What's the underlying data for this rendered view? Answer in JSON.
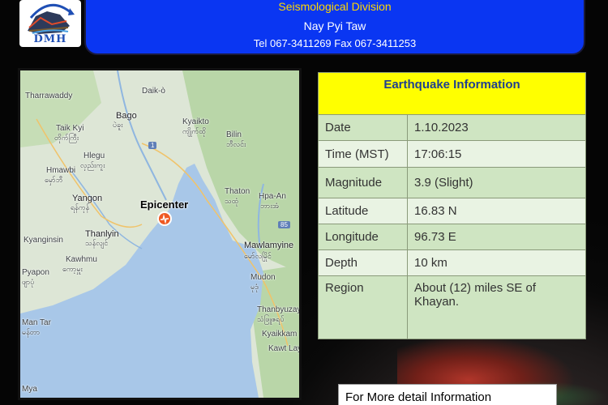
{
  "header": {
    "division": "Seismological Division",
    "city": "Nay Pyi Taw",
    "contact": "Tel 067-3411269 Fax 067-3411253",
    "logo_text": "DMH"
  },
  "map": {
    "epicenter_label": "Epicenter",
    "places": {
      "daik": "Daik-ò",
      "tharrawaddy": "Tharrawaddy",
      "bago": "Bago",
      "bago_my": "ပဲခူး",
      "kyaikto": "Kyaikto",
      "kyaikto_my": "ကျိုက်ထို",
      "bilin": "Bilin",
      "bilin_my": "ဘီလင်း",
      "taikkyi": "Taik Kyi",
      "taikkyi_my": "တိုက်ကြီး",
      "hlegu": "Hlegu",
      "hlegu_my": "လှည်းကူး",
      "hmawbi": "Hmawbi",
      "hmawbi_my": "မှော်ဘီ",
      "yangon": "Yangon",
      "yangon_my": "ရန်ကုန်",
      "thaton": "Thaton",
      "thaton_my": "သထုံ",
      "hpaan": "Hpa-An",
      "hpaan_my": "ဘားအံ",
      "kyangin": "Kyanginsin",
      "thanlyin": "Thanlyin",
      "thanlyin_my": "သန်လျင်",
      "kawhmu": "Kawhmu",
      "kawhmu_my": "ကော့မှူး",
      "mawlamyine": "Mawlamyine",
      "mawlamyine_my": "မော်လမြိုင်",
      "pyapon": "Pyapon",
      "pyapon_my": "ဖျာပုံ",
      "mudon": "Mudon",
      "mudon_my": "မုဒုံ",
      "thanbyuzayat": "Thanbyuzay",
      "thanbyuzayat_my": "သံဖြူဇရပ်",
      "mantar": "Man Tar",
      "mantar_my": "မန်တာ",
      "kyaikkami": "Kyaikkam",
      "kawtlay": "Kawt Lay",
      "mya": "Mya",
      "shield_85": "85",
      "shield_1": "1"
    }
  },
  "info": {
    "title": "Earthquake Information",
    "rows": [
      {
        "label": "Date",
        "value": "1.10.2023"
      },
      {
        "label": "Time (MST)",
        "value": "17:06:15"
      },
      {
        "label": "Magnitude",
        "value": "3.9 (Slight)"
      },
      {
        "label": "Latitude",
        "value": "16.83 N"
      },
      {
        "label": "Longitude",
        "value": "96.73 E"
      },
      {
        "label": "Depth",
        "value": "10 km"
      },
      {
        "label": "Region",
        "value": "About (12) miles SE of Khayan."
      }
    ]
  },
  "footer": {
    "more_info": "For More detail Information"
  },
  "colors": {
    "header_blue": "#0a36f2",
    "division_yellow": "#ffd800",
    "title_yellow": "#ffff00",
    "row_dark": "#cfe5c2",
    "row_light": "#e9f3e3",
    "sea": "#a8c7e8",
    "land": "#dde6d6",
    "epicenter": "#ef5a24"
  }
}
